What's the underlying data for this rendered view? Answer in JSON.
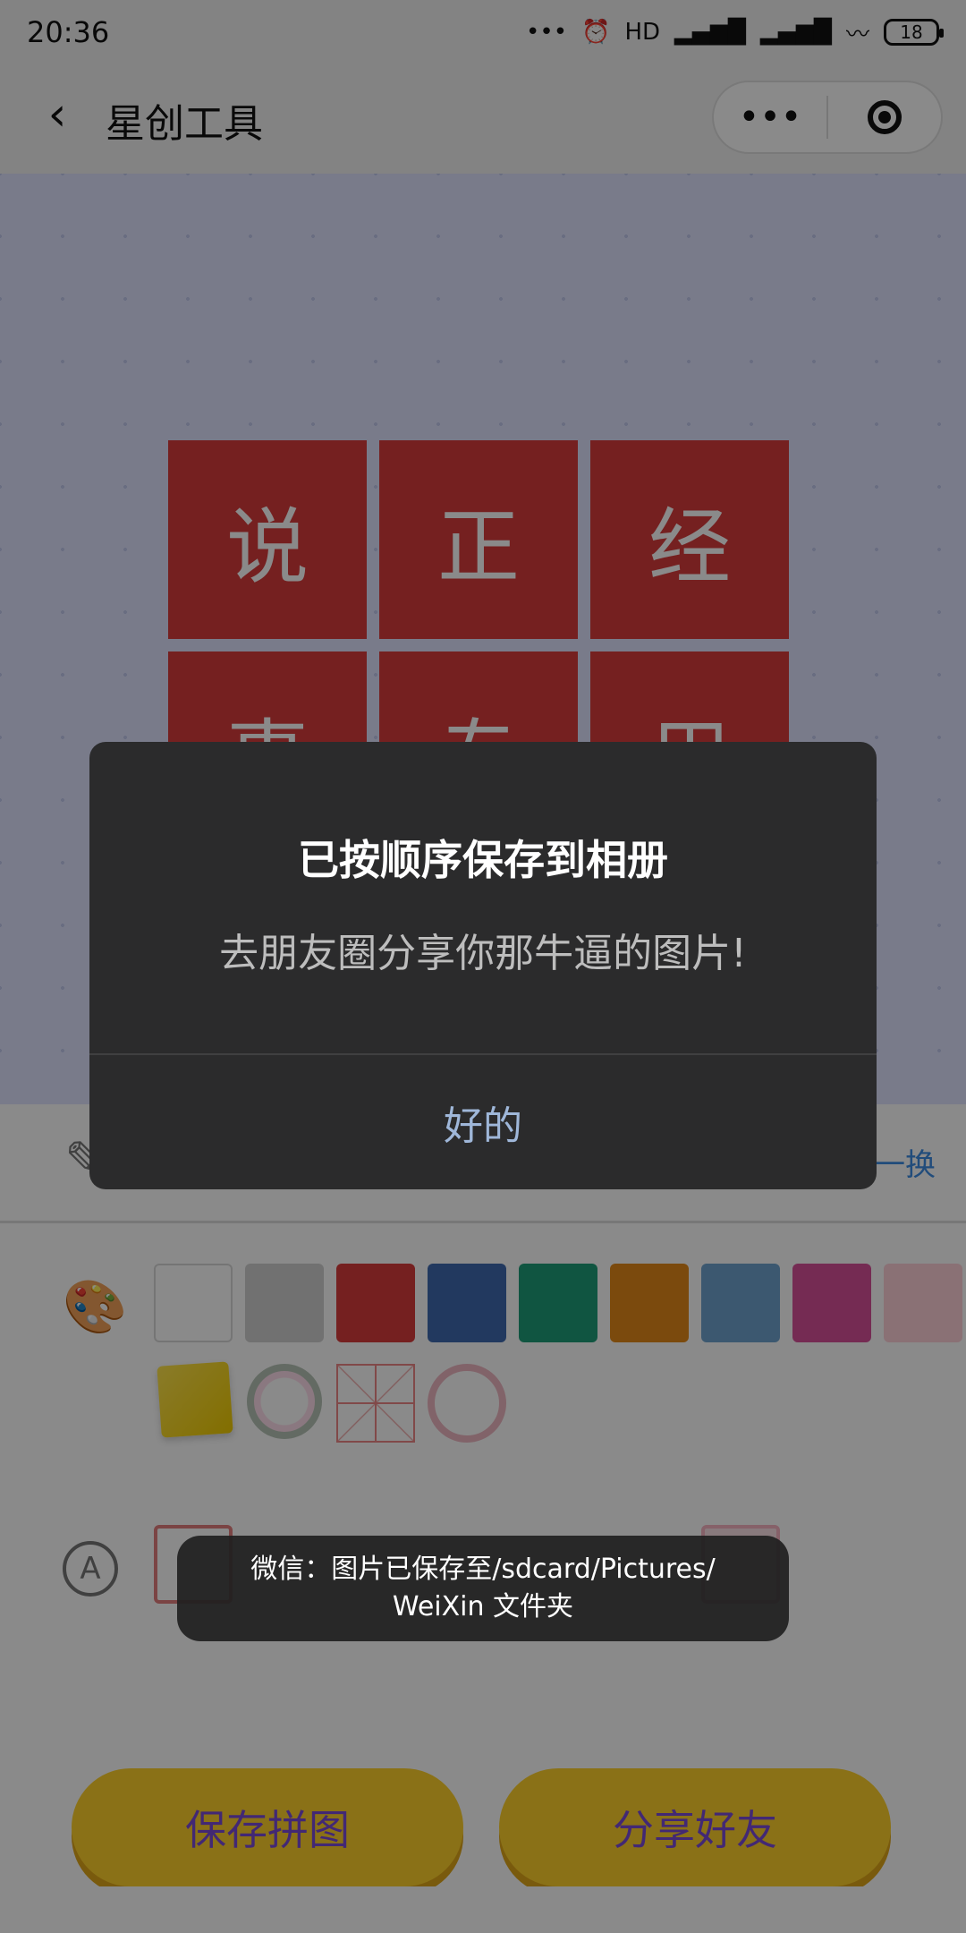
{
  "status_bar": {
    "time": "20:36",
    "signal_text": "HD",
    "battery": "18"
  },
  "header": {
    "title": "星创工具",
    "more_label": "•••"
  },
  "puzzle": {
    "tiles": [
      "说",
      "正",
      "经",
      "事",
      "专",
      "用",
      "",
      "",
      ""
    ],
    "tile_color": "#d93b3b"
  },
  "tools": {
    "change_label": "换一换",
    "swatches": [
      "#ffffff",
      "#d1d1d1",
      "#d93b3b",
      "#3f6ab0",
      "#1f9e79",
      "#e48a19",
      "#6fa3cf",
      "#d9509a",
      "#ffd1d9"
    ],
    "stickers": [
      "sticky-note",
      "flower-wreath",
      "mizi-grid",
      "ring-frame"
    ]
  },
  "modal": {
    "title": "已按顺序保存到相册",
    "message": "去朋友圈分享你那牛逼的图片!",
    "ok_label": "好的"
  },
  "toast": {
    "line1": "微信：图片已保存至/sdcard/Pictures/",
    "line2": "WeiXin 文件夹"
  },
  "buttons": {
    "save_label": "保存拼图",
    "share_label": "分享好友"
  }
}
